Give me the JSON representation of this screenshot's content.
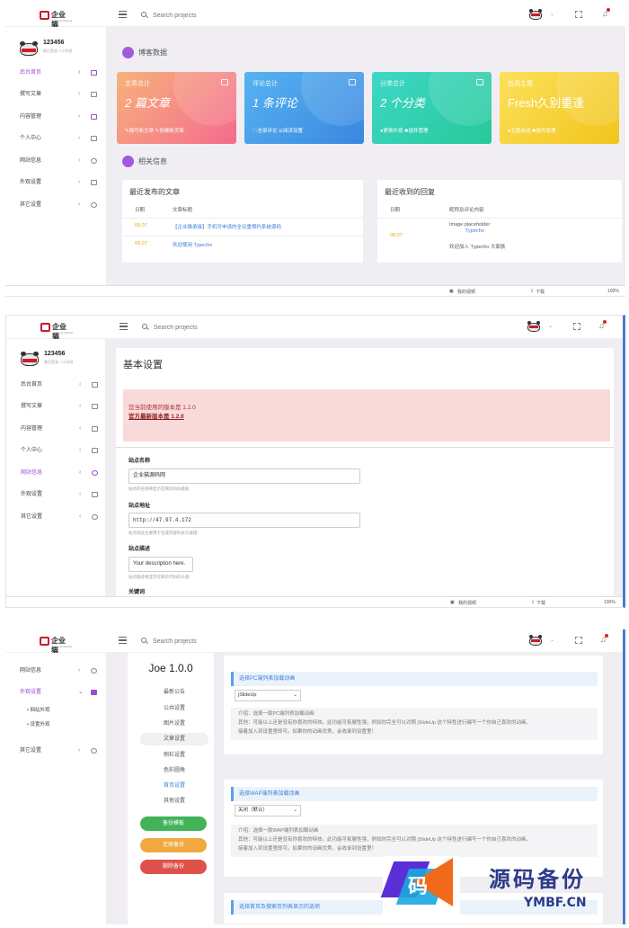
{
  "topbar": {
    "logo_text": "企业猫",
    "logo_sub": "WWW.QIYEMAO",
    "search_placeholder": "Search projects"
  },
  "profile": {
    "name": "123456",
    "last_login": "最后登录: 2小时前"
  },
  "sidebar_full": [
    "后台首页",
    "撰写文章",
    "内容管理",
    "个人中心",
    "网站信息",
    "外观设置",
    "其它设置"
  ],
  "sidebar_sub": {
    "items": [
      "网站信息",
      "外观设置",
      "其它设置"
    ],
    "children": [
      "网站外观",
      "设置外观"
    ]
  },
  "colors": {
    "accent": "#9b4dd6",
    "card1": "#f88a9a",
    "card2": "#3d9fe8",
    "card3": "#2dd3b3",
    "card4": "#f5d32e"
  },
  "dashboard": {
    "section1": "博客数据",
    "cards": [
      {
        "title": "文章总计",
        "value": "2 篇文章",
        "links": "✎撰写新文章  ✎创建新页面"
      },
      {
        "title": "评论总计",
        "value": "1 条评论",
        "links": "☁全部评论  ☰阅读设置"
      },
      {
        "title": "分类总计",
        "value": "2 个分类",
        "links": "●更换外观  ✱插件管理"
      },
      {
        "title": "启用主题",
        "value": "Fresh久别重逢",
        "links": "●主题启动  ✱插件管理"
      }
    ],
    "section2": "相关信息",
    "recent_posts": {
      "title": "最近发布的文章",
      "headers": [
        "日期",
        "文章标题"
      ],
      "rows": [
        {
          "date": "09.07",
          "title": "【企业猫承接】手机可申请的全议重预约系统源码"
        },
        {
          "date": "09.07",
          "title": "欢迎使用 Typecho"
        }
      ]
    },
    "recent_replies": {
      "title": "最近收到的回复",
      "headers": [
        "日期",
        "昵称及评论内容"
      ],
      "row": {
        "date": "09.07",
        "img": "Image placeholder",
        "name": "Typecho",
        "text": "欢迎加入 Typecho 大家族"
      }
    }
  },
  "settings": {
    "title": "基本设置",
    "alert_line1": "您当前使用的版本是 1.2.0",
    "alert_line2": "官方最新版本是 1.2.0",
    "fields": [
      {
        "label": "站点名称",
        "value": "企业猫源码网",
        "desc": "站点的名称将显示在网页的标题处."
      },
      {
        "label": "站点地址",
        "value": "http://47.97.4.172",
        "desc": "站点地址主要用于生成内容的永久链接."
      },
      {
        "label": "站点描述",
        "value": "Your description here.",
        "desc": "站点描述将显示在网页代码的头部."
      },
      {
        "label": "关键词",
        "value": "",
        "desc": ""
      }
    ]
  },
  "joe": {
    "title": "Joe 1.0.0",
    "links": [
      "最新公告",
      "公共设置",
      "图片设置",
      "文章设置",
      "侧栏设置",
      "色彩圆角",
      "首页设置",
      "其他设置"
    ],
    "buttons": [
      "备份模板",
      "还原备份",
      "删除备份"
    ],
    "opt1": {
      "head": "选择PC端列表加载动画",
      "select": "jSlideUp",
      "desc1": "介绍：选择一款PC端列表加载动画",
      "desc2": "其他：可能以上还是没有你喜欢的特效。此功能可拓展性强，例如你完全可以对照 jSlideUp 这个特性进行编写一个你自己喜欢的动画，",
      "desc3": "接着加入到设置里即可。如果你的动画优秀，会收录到设置里！"
    },
    "opt2": {
      "head": "选择WAP端列表加载动画",
      "select": "关闭（默认）",
      "desc1": "介绍：选择一款WAP端列表加载动画",
      "desc2": "其他：可能以上还是没有你喜欢的特效。此功能可拓展性强，例如你完全可以对照 jSlideUp 这个特性进行编写一个你自己喜欢的动画，",
      "desc3": "接着加入到设置里即可。如果你的动画优秀，会收录到设置里！"
    },
    "opt3": {
      "head": "选择首页及搜索页列表显示的选项"
    }
  },
  "statusbar": {
    "video": "我的视频",
    "download": "下载",
    "zoom": "100%"
  },
  "watermark": {
    "char": "码",
    "big": "源码备份",
    "small": "YMBF.CN"
  }
}
